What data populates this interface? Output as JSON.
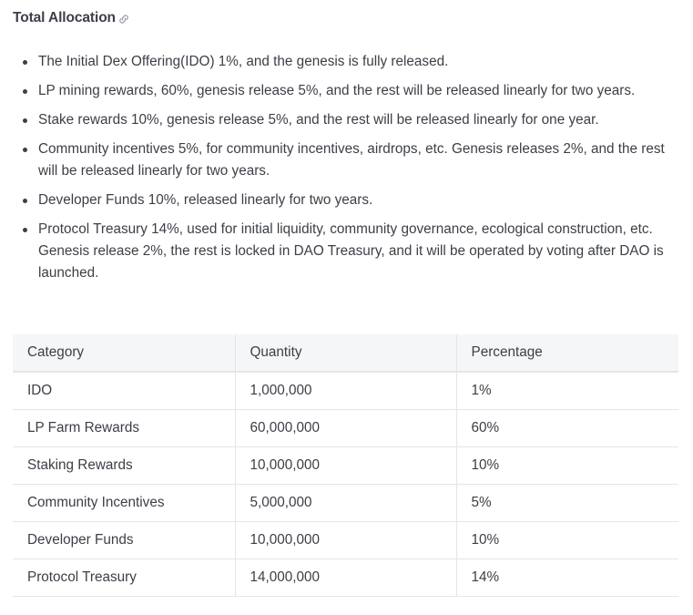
{
  "heading": "Total Allocation",
  "heading_icon": "link-icon",
  "bullets": [
    "The Initial Dex Offering(IDO) 1%, and the genesis is fully released.",
    "LP mining rewards, 60%, genesis release 5%, and the rest will be released linearly for two years.",
    "Stake rewards 10%, genesis release 5%, and the rest will be released linearly for one year.",
    "Community incentives 5%, for community incentives, airdrops, etc. Genesis releases 2%, and the rest will be released linearly for two years.",
    "Developer Funds 10%, released linearly for two years.",
    "Protocol Treasury 14%, used for initial liquidity, community governance, ecological construction, etc. Genesis release 2%, the rest is locked in DAO Treasury, and it will be operated by voting after DAO is launched."
  ],
  "table": {
    "headers": [
      "Category",
      "Quantity",
      "Percentage"
    ],
    "rows": [
      [
        "IDO",
        "1,000,000",
        "1%"
      ],
      [
        "LP Farm Rewards",
        "60,000,000",
        "60%"
      ],
      [
        "Staking Rewards",
        "10,000,000",
        "10%"
      ],
      [
        "Community Incentives",
        "5,000,000",
        "5%"
      ],
      [
        "Developer Funds",
        "10,000,000",
        "10%"
      ],
      [
        "Protocol Treasury",
        "14,000,000",
        "14%"
      ]
    ]
  },
  "colors": {
    "text": "#3b3f46",
    "header_bg": "#f5f6f7",
    "border": "#e3e5e8"
  }
}
